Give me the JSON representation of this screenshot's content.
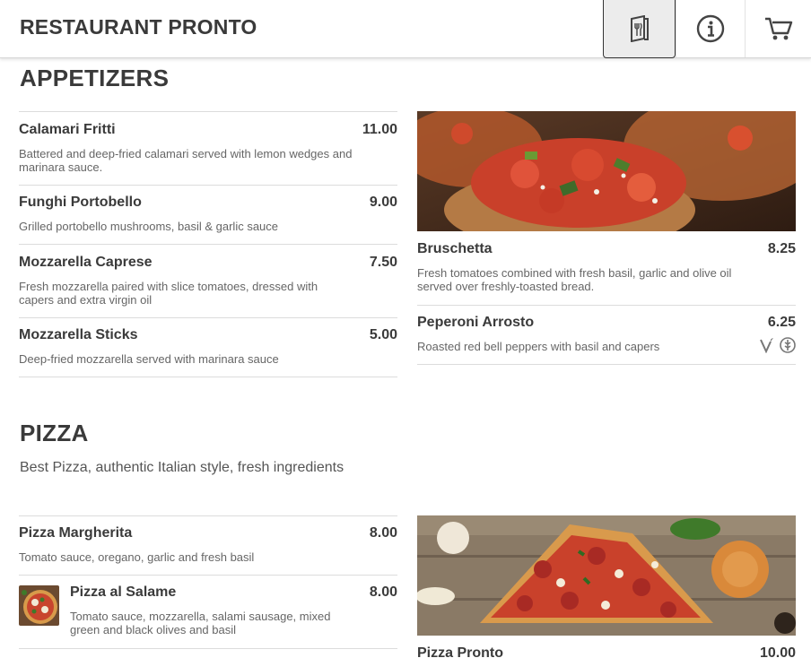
{
  "header": {
    "title": "RESTAURANT PRONTO",
    "icons": [
      "menu-book-icon",
      "info-icon",
      "cart-icon"
    ]
  },
  "appetizers": {
    "title": "APPETIZERS",
    "items": [
      {
        "name": "Calamari Fritti",
        "price": "11.00",
        "desc": "Battered and deep-fried calamari served with lemon wedges and marinara sauce."
      },
      {
        "name": "Funghi Portobello",
        "price": "9.00",
        "desc": "Grilled portobello mushrooms, basil & garlic sauce"
      },
      {
        "name": "Mozzarella Caprese",
        "price": "7.50",
        "desc": "Fresh mozzarella paired with slice tomatoes, dressed with capers and extra virgin oil"
      },
      {
        "name": "Mozzarella Sticks",
        "price": "5.00",
        "desc": "Deep-fried mozzarella served with marinara sauce"
      }
    ],
    "right_items": [
      {
        "name": "Bruschetta",
        "price": "8.25",
        "desc": "Fresh tomatoes combined with fresh basil, garlic and olive oil served over freshly-toasted bread."
      },
      {
        "name": "Peperoni Arrosto",
        "price": "6.25",
        "desc": "Roasted red bell peppers with basil and capers",
        "badges": [
          "vegan-icon",
          "gluten-free-icon"
        ]
      }
    ]
  },
  "pizza": {
    "title": "PIZZA",
    "description": "Best Pizza, authentic Italian style, fresh ingredients",
    "items": [
      {
        "name": "Pizza Margherita",
        "price": "8.00",
        "desc": "Tomato sauce, oregano, garlic and fresh basil"
      },
      {
        "name": "Pizza al Salame",
        "price": "8.00",
        "desc": "Tomato sauce, mozzarella, salami sausage, mixed green and black olives and basil"
      }
    ],
    "right_items": [
      {
        "name": "Pizza Pronto",
        "price": "10.00"
      }
    ]
  },
  "colors": {
    "text": "#3a3a3a",
    "muted": "#666666",
    "divider": "#dcdcdc",
    "active_tab_bg": "#ececec"
  }
}
